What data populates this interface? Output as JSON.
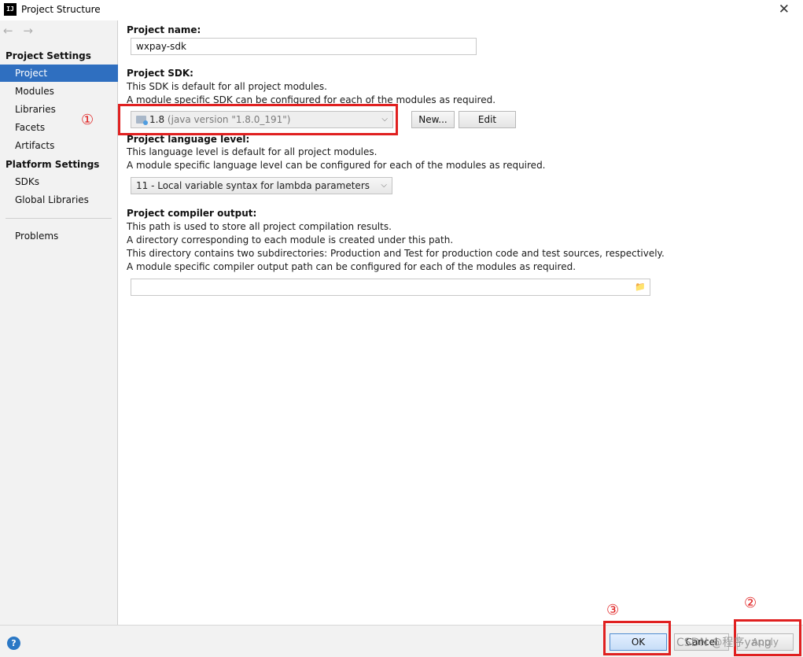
{
  "window": {
    "app_icon": "IJ",
    "title": "Project Structure",
    "close_glyph": "✕"
  },
  "nav": {
    "back_glyph": "←",
    "forward_glyph": "→"
  },
  "sidebar": {
    "project_settings_header": "Project Settings",
    "project_settings_items": [
      {
        "label": "Project",
        "selected": true
      },
      {
        "label": "Modules"
      },
      {
        "label": "Libraries"
      },
      {
        "label": "Facets"
      },
      {
        "label": "Artifacts"
      }
    ],
    "platform_settings_header": "Platform Settings",
    "platform_settings_items": [
      {
        "label": "SDKs"
      },
      {
        "label": "Global Libraries"
      }
    ],
    "problems_label": "Problems"
  },
  "project": {
    "name_label": "Project name:",
    "name_value": "wxpay-sdk",
    "sdk_label": "Project SDK:",
    "sdk_desc_1": "This SDK is default for all project modules.",
    "sdk_desc_2": "A module specific SDK can be configured for each of the modules as required.",
    "sdk_value": "1.8",
    "sdk_value_detail": "(java version \"1.8.0_191\")",
    "sdk_new_button": "New...",
    "sdk_edit_button": "Edit",
    "lang_label": "Project language level:",
    "lang_desc_1": "This language level is default for all project modules.",
    "lang_desc_2": "A module specific language level can be configured for each of the modules as required.",
    "lang_value": "11 - Local variable syntax for lambda parameters",
    "output_label": "Project compiler output:",
    "output_desc_1": "This path is used to store all project compilation results.",
    "output_desc_2": "A directory corresponding to each module is created under this path.",
    "output_desc_3": "This directory contains two subdirectories: Production and Test for production code and test sources, respectively.",
    "output_desc_4": "A module specific compiler output path can be configured for each of the modules as required.",
    "output_value": ""
  },
  "footer": {
    "help_glyph": "?",
    "ok_label": "OK",
    "cancel_label": "Cancel",
    "apply_label": "Apply"
  },
  "annotations": {
    "mark_1": "①",
    "mark_2": "②",
    "mark_3": "③",
    "color": "#e02020"
  },
  "watermark": "CSDN @程序yang",
  "colors": {
    "selection": "#2f6fc0",
    "sidebar_bg": "#f2f2f2",
    "help_icon": "#2b78c5"
  }
}
